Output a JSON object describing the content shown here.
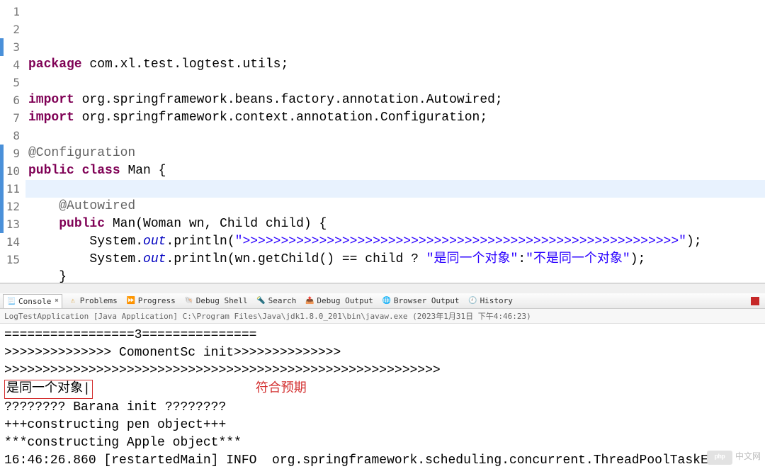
{
  "code": {
    "lines": [
      {
        "n": 1,
        "segments": [
          {
            "t": "package ",
            "c": "kw"
          },
          {
            "t": "com.xl.test.logtest.utils;"
          }
        ]
      },
      {
        "n": 2,
        "segments": []
      },
      {
        "n": 3,
        "segments": [
          {
            "t": "import ",
            "c": "kw"
          },
          {
            "t": "org.springframework.beans.factory.annotation.Autowired;"
          }
        ]
      },
      {
        "n": 4,
        "segments": [
          {
            "t": "import ",
            "c": "kw"
          },
          {
            "t": "org.springframework.context.annotation.Configuration;"
          }
        ]
      },
      {
        "n": 5,
        "segments": []
      },
      {
        "n": 6,
        "segments": [
          {
            "t": "@Configuration",
            "c": "ann"
          }
        ]
      },
      {
        "n": 7,
        "segments": [
          {
            "t": "public class ",
            "c": "kw"
          },
          {
            "t": "Man {"
          }
        ]
      },
      {
        "n": 8,
        "segments": []
      },
      {
        "n": 9,
        "segments": [
          {
            "t": "    "
          },
          {
            "t": "@Autowired",
            "c": "ann"
          }
        ]
      },
      {
        "n": 10,
        "segments": [
          {
            "t": "    "
          },
          {
            "t": "public ",
            "c": "kw"
          },
          {
            "t": "Man(Woman wn, Child child) {"
          }
        ]
      },
      {
        "n": 11,
        "segments": [
          {
            "t": "        System."
          },
          {
            "t": "out",
            "c": "italic"
          },
          {
            "t": ".println("
          },
          {
            "t": "\">>>>>>>>>>>>>>>>>>>>>>>>>>>>>>>>>>>>>>>>>>>>>>>>>>>>>>>>>\"",
            "c": "str"
          },
          {
            "t": ");"
          }
        ]
      },
      {
        "n": 12,
        "segments": [
          {
            "t": "        System."
          },
          {
            "t": "out",
            "c": "italic"
          },
          {
            "t": ".println(wn.getChild() == child ? "
          },
          {
            "t": "\"是同一个对象\"",
            "c": "str"
          },
          {
            "t": ":"
          },
          {
            "t": "\"不是同一个对象\"",
            "c": "str"
          },
          {
            "t": ");"
          }
        ]
      },
      {
        "n": 13,
        "segments": [
          {
            "t": "    }"
          }
        ]
      },
      {
        "n": 14,
        "segments": [
          {
            "t": "}"
          }
        ]
      },
      {
        "n": 15,
        "segments": []
      }
    ],
    "markers": [
      {
        "line": 3,
        "type": "import"
      },
      {
        "line": 9,
        "span": 5
      }
    ],
    "highlight_line": 11
  },
  "tabs": {
    "items": [
      {
        "label": "Console",
        "icon": "📃",
        "icon_class": "icon-console",
        "active": true,
        "pinnable": true
      },
      {
        "label": "Problems",
        "icon": "⚠",
        "icon_class": "icon-problems"
      },
      {
        "label": "Progress",
        "icon": "⏩",
        "icon_class": "icon-progress"
      },
      {
        "label": "Debug Shell",
        "icon": "🐚",
        "icon_class": "icon-debug"
      },
      {
        "label": "Search",
        "icon": "🔦",
        "icon_class": "icon-search"
      },
      {
        "label": "Debug Output",
        "icon": "📤",
        "icon_class": "icon-debug"
      },
      {
        "label": "Browser Output",
        "icon": "🌐",
        "icon_class": "icon-console"
      },
      {
        "label": "History",
        "icon": "🕘",
        "icon_class": "icon-history"
      }
    ]
  },
  "run_info": "LogTestApplication [Java Application] C:\\Program Files\\Java\\jdk1.8.0_201\\bin\\javaw.exe (2023年1月31日 下午4:46:23)",
  "console": {
    "lines": [
      {
        "text": "=================3==============="
      },
      {
        "text": ">>>>>>>>>>>>>> ComonentSc init>>>>>>>>>>>>>>"
      },
      {
        "text": ">>>>>>>>>>>>>>>>>>>>>>>>>>>>>>>>>>>>>>>>>>>>>>>>>>>>>>>>>"
      },
      {
        "text": "是同一个对象",
        "boxed": true,
        "cursor": true,
        "annotation": "符合预期"
      },
      {
        "text": "???????? Barana init ????????"
      },
      {
        "text": "+++constructing pen object+++"
      },
      {
        "text": "***constructing Apple object***"
      },
      {
        "text": "16:46:26.860 [restartedMain] INFO  org.springframework.scheduling.concurrent.ThreadPoolTaskE"
      }
    ]
  },
  "watermark": {
    "logo": "php",
    "text": "中文网"
  }
}
